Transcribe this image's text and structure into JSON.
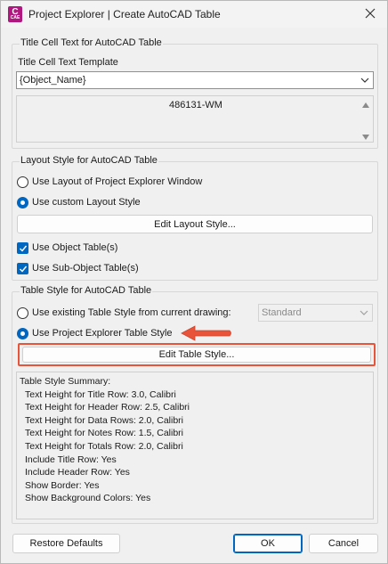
{
  "window": {
    "title": "Project Explorer | Create AutoCAD Table",
    "app_icon_letter": "C",
    "app_icon_sub": "CAE"
  },
  "title_cell": {
    "group_title": "Title Cell Text for AutoCAD Table",
    "template_label": "Title Cell Text Template",
    "template_value": "{Object_Name}",
    "preview_value": "486131-WM"
  },
  "layout_style": {
    "group_title": "Layout Style for AutoCAD Table",
    "option_window": "Use Layout of Project Explorer Window",
    "option_custom": "Use custom Layout Style",
    "edit_button": "Edit Layout Style...",
    "use_object_tables": "Use Object Table(s)",
    "use_subobject_tables": "Use Sub-Object Table(s)"
  },
  "table_style": {
    "group_title": "Table Style for AutoCAD Table",
    "option_existing": "Use existing Table Style from current drawing:",
    "existing_value": "Standard",
    "option_pe": "Use Project Explorer Table Style",
    "edit_button": "Edit Table Style...",
    "summary": [
      "Table Style Summary:",
      "Text Height for Title Row: 3.0, Calibri",
      "Text Height for Header Row: 2.5, Calibri",
      "Text Height for Data Rows: 2.0, Calibri",
      "Text Height for Notes Row: 1.5, Calibri",
      "Text Height for Totals Row: 2.0, Calibri",
      "Include Title Row: Yes",
      "Include Header Row: Yes",
      "Show Border: Yes",
      "Show Background Colors: Yes"
    ]
  },
  "footer": {
    "restore_button": "Restore Defaults",
    "ok_button": "OK",
    "cancel_button": "Cancel"
  },
  "colors": {
    "accent": "#0067c0",
    "annotation": "#e8543a",
    "app_icon": "#b0187f"
  }
}
